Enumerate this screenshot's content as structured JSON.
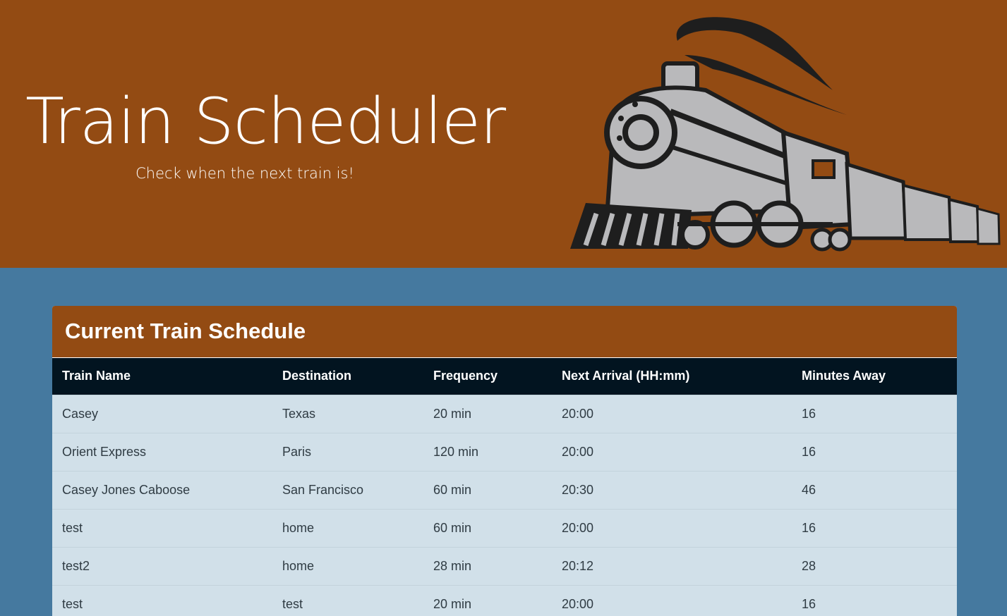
{
  "hero": {
    "title": "Train Scheduler",
    "subtitle": "Check when the next train is!",
    "image": "locomotive-illustration"
  },
  "schedule": {
    "title": "Current Train Schedule",
    "columns": [
      "Train Name",
      "Destination",
      "Frequency",
      "Next Arrival (HH:mm)",
      "Minutes Away"
    ],
    "rows": [
      [
        "Casey",
        "Texas",
        "20 min",
        "20:00",
        "16"
      ],
      [
        "Orient Express",
        "Paris",
        "120 min",
        "20:00",
        "16"
      ],
      [
        "Casey Jones Caboose",
        "San Francisco",
        "60 min",
        "20:30",
        "46"
      ],
      [
        "test",
        "home",
        "60 min",
        "20:00",
        "16"
      ],
      [
        "test2",
        "home",
        "28 min",
        "20:12",
        "28"
      ],
      [
        "test",
        "test",
        "20 min",
        "20:00",
        "16"
      ]
    ]
  },
  "colors": {
    "header_brown": "#934b13",
    "page_blue": "#45799f",
    "table_head": "#021420",
    "table_body": "#d1e0e9"
  }
}
